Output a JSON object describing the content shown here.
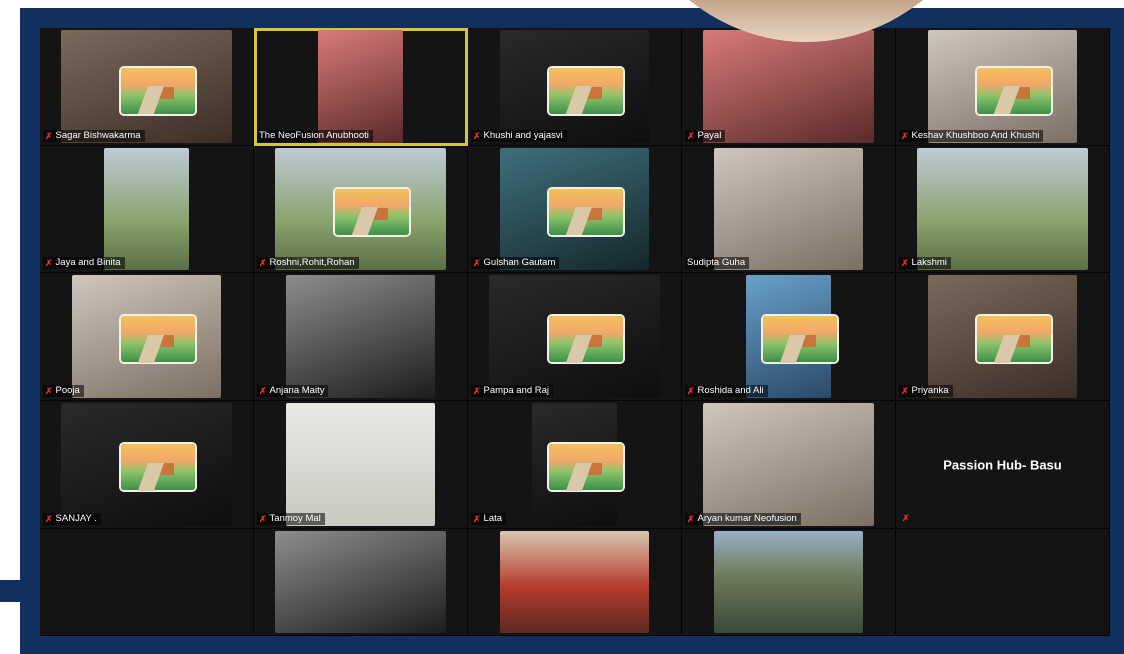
{
  "participants": [
    {
      "name": "Sagar Bishwakarma",
      "style": "v-warm",
      "painting": true,
      "muted": true
    },
    {
      "name": "The NeoFusion Anubhooti",
      "style": "v-pink",
      "painting": false,
      "muted": false,
      "active": true
    },
    {
      "name": "Khushi and yajasvi",
      "style": "v-dark",
      "painting": true,
      "muted": true
    },
    {
      "name": "Payal",
      "style": "v-pink",
      "painting": false,
      "muted": true
    },
    {
      "name": "Keshav Khushboo And Khushi",
      "style": "v-room",
      "painting": true,
      "muted": true
    },
    {
      "name": "Jaya and Binita",
      "style": "v-sky",
      "painting": false,
      "muted": true
    },
    {
      "name": "Roshni,Rohit,Rohan",
      "style": "v-sky",
      "painting": true,
      "muted": true
    },
    {
      "name": "Gulshan Gautam",
      "style": "v-teal",
      "painting": true,
      "muted": true
    },
    {
      "name": "Sudipta Guha",
      "style": "v-room",
      "painting": false,
      "muted": false
    },
    {
      "name": "Lakshmi",
      "style": "v-sky",
      "painting": false,
      "muted": true
    },
    {
      "name": "Pooja",
      "style": "v-room",
      "painting": true,
      "muted": true
    },
    {
      "name": "Anjana Maity",
      "style": "v-bw",
      "painting": false,
      "muted": true
    },
    {
      "name": "Pampa and Raj",
      "style": "v-dark",
      "painting": true,
      "muted": true
    },
    {
      "name": "Roshida and Ali",
      "style": "v-blue",
      "painting": true,
      "muted": true
    },
    {
      "name": "Priyanka",
      "style": "v-warm",
      "painting": true,
      "muted": true
    },
    {
      "name": "SANJAY .",
      "style": "v-dark",
      "painting": true,
      "muted": true
    },
    {
      "name": "Tanmoy Mal",
      "style": "v-paper",
      "painting": false,
      "muted": true
    },
    {
      "name": "Lata",
      "style": "v-dark",
      "painting": true,
      "muted": true
    },
    {
      "name": "Aryan kumar Neofusion",
      "style": "v-room",
      "painting": false,
      "muted": true
    },
    {
      "name": "Passion Hub- Basu",
      "style": "none",
      "painting": false,
      "muted": true,
      "no_video": true
    },
    {
      "name": "",
      "style": "none",
      "painting": false,
      "muted": false,
      "no_video": true
    },
    {
      "name": "",
      "style": "v-bw",
      "painting": false,
      "muted": false
    },
    {
      "name": "",
      "style": "v-red",
      "painting": false,
      "muted": false
    },
    {
      "name": "",
      "style": "v-field",
      "painting": false,
      "muted": false
    },
    {
      "name": "",
      "style": "none",
      "painting": false,
      "muted": false,
      "no_video": true
    }
  ],
  "colors": {
    "frame": "#12305e",
    "active_border": "#d7c43a",
    "muted_icon": "#e0302a"
  },
  "icons": {
    "muted": "mic-muted-icon"
  }
}
